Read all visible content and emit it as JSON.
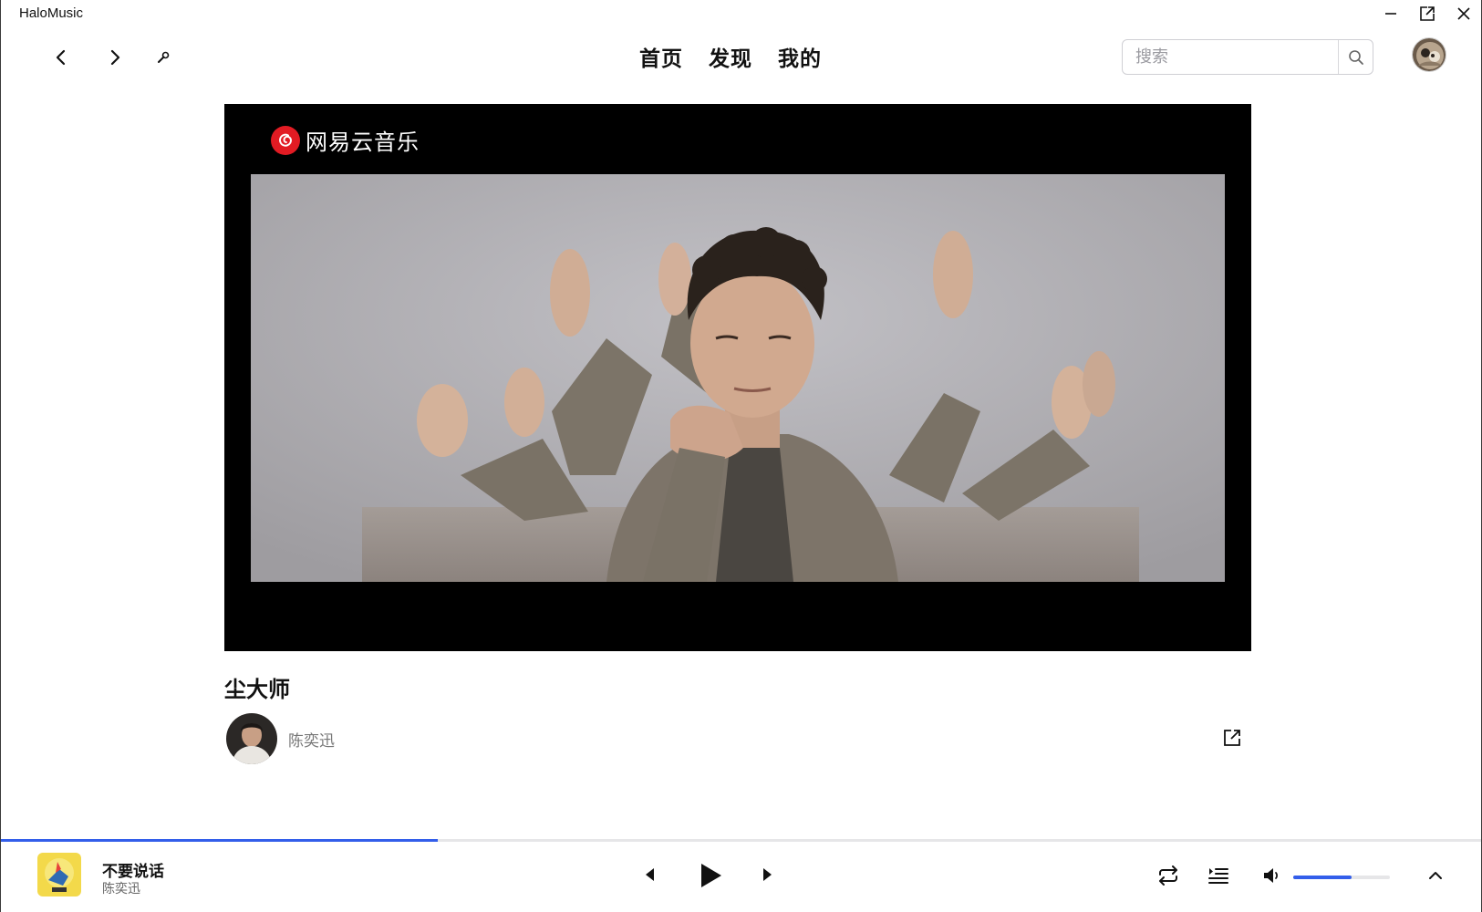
{
  "app": {
    "title": "HaloMusic"
  },
  "nav": {
    "tabs": [
      {
        "label": "首页"
      },
      {
        "label": "发现"
      },
      {
        "label": "我的"
      }
    ],
    "search": {
      "placeholder": "搜索",
      "value": ""
    }
  },
  "video": {
    "watermark": "网易云音乐",
    "title": "尘大师",
    "artist": "陈奕迅"
  },
  "player": {
    "track_title": "不要说话",
    "track_artist": "陈奕迅",
    "progress_fraction": 0.295,
    "volume_fraction": 0.6
  },
  "colors": {
    "accent": "#335eea",
    "logo_red": "#e21b23",
    "video_bg": "#000000"
  },
  "icons": {
    "titlebar": [
      "minimize-icon",
      "popout-icon",
      "close-icon"
    ],
    "nav": [
      "arrow-left-icon",
      "arrow-right-icon",
      "wrench-icon",
      "search-icon"
    ],
    "player": [
      "skip-previous-icon",
      "play-icon",
      "skip-next-icon",
      "repeat-icon",
      "playlist-icon",
      "volume-icon",
      "chevron-up-icon"
    ],
    "video": [
      "external-link-icon"
    ]
  }
}
